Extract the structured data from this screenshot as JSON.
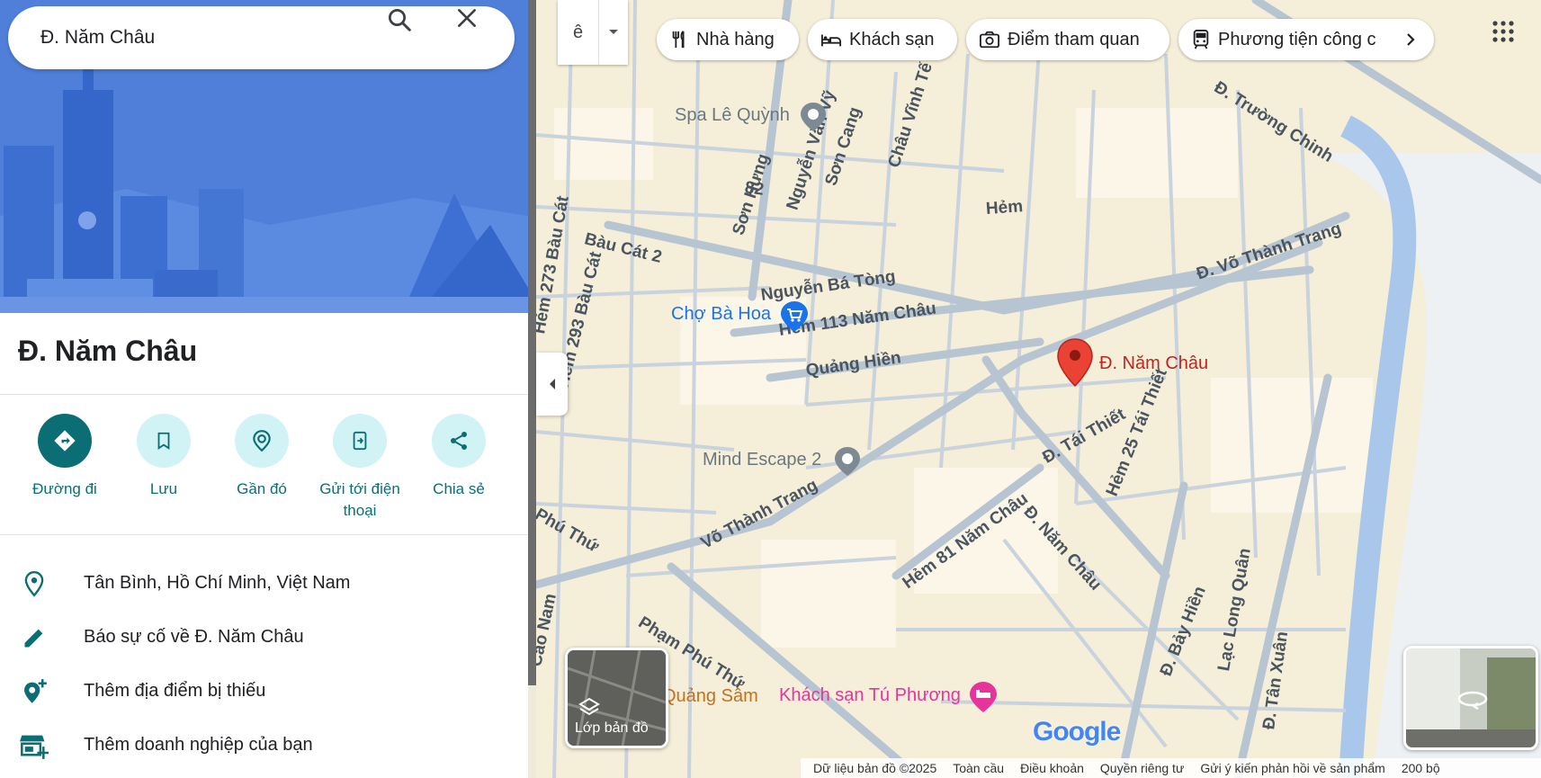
{
  "search": {
    "value": "Đ. Năm Châu"
  },
  "place": {
    "title": "Đ. Năm Châu"
  },
  "actions": [
    {
      "label": "Đường đi",
      "icon": "directions-icon"
    },
    {
      "label": "Lưu",
      "icon": "bookmark-icon"
    },
    {
      "label": "Gần đó",
      "icon": "nearby-icon"
    },
    {
      "label": "Gửi tới điện thoại",
      "icon": "send-to-phone-icon"
    },
    {
      "label": "Chia sẻ",
      "icon": "share-icon"
    }
  ],
  "info": [
    {
      "text": "Tân Bình, Hồ Chí Minh, Việt Nam",
      "icon": "location-pin-icon"
    },
    {
      "text": "Báo sự cố về Đ. Năm Châu",
      "icon": "pencil-icon"
    },
    {
      "text": "Thêm địa điểm bị thiếu",
      "icon": "add-place-icon"
    },
    {
      "text": "Thêm doanh nghiệp của bạn",
      "icon": "add-business-icon"
    }
  ],
  "map": {
    "lang_glyph": "ê",
    "chips": [
      {
        "label": "Nhà hàng",
        "icon": "restaurant-icon"
      },
      {
        "label": "Khách sạn",
        "icon": "hotel-icon"
      },
      {
        "label": "Điểm tham quan",
        "icon": "camera-icon"
      },
      {
        "label": "Phương tiện công c",
        "icon": "transit-icon"
      }
    ],
    "streets": [
      "Bàu Cát 2",
      "Nguyễn Bá Tòng",
      "Hẻm 113 Năm Châu",
      "Quảng Hiền",
      "Võ Thành Trang",
      "Đ. Võ Thành Trang",
      "Đ. Trường Chinh",
      "Phạm Phú Thứ",
      "Đ. Năm Châu",
      "Hẻm 81 Năm Châu",
      "Đ. Tái Thiết",
      "Hẻm 25 Tái Thiết",
      "Hẻm",
      "Sơn Hưng",
      "Nguyễn Văn Vỹ",
      "Sơn Cang",
      "Châu Vĩnh Tế",
      "Hẻm 293 Bàu Cát",
      "Hẻm 273 Bàu Cát",
      "Đ. Bảy Hiền",
      "Lạc Long Quân",
      "Đ. Tân Xuân",
      "82",
      "Phú Thứ",
      "Quảng Sâm",
      "Cao Nam"
    ],
    "pois": [
      {
        "label": "Spa Lê Quỳnh",
        "color": "#6b7780"
      },
      {
        "label": "Chợ Bà Hoa",
        "color": "#1a73e8"
      },
      {
        "label": "Mind Escape 2",
        "color": "#6b7780"
      },
      {
        "label": "Khách sạn Tú Phương",
        "color": "#e5359c"
      }
    ],
    "pin_label": "Đ. Năm Châu",
    "layers_label": "Lớp bản đồ",
    "logo": "Google",
    "footer": [
      "Dữ liệu bản đồ ©2025",
      "Toàn cầu",
      "Điều khoản",
      "Quyền riêng tư",
      "Gửi ý kiến phản hồi về sản phẩm",
      "200 bộ"
    ]
  },
  "colors": {
    "accent": "#0b6e75",
    "pin": "#ea4335",
    "hero": "#4f7fd9"
  }
}
